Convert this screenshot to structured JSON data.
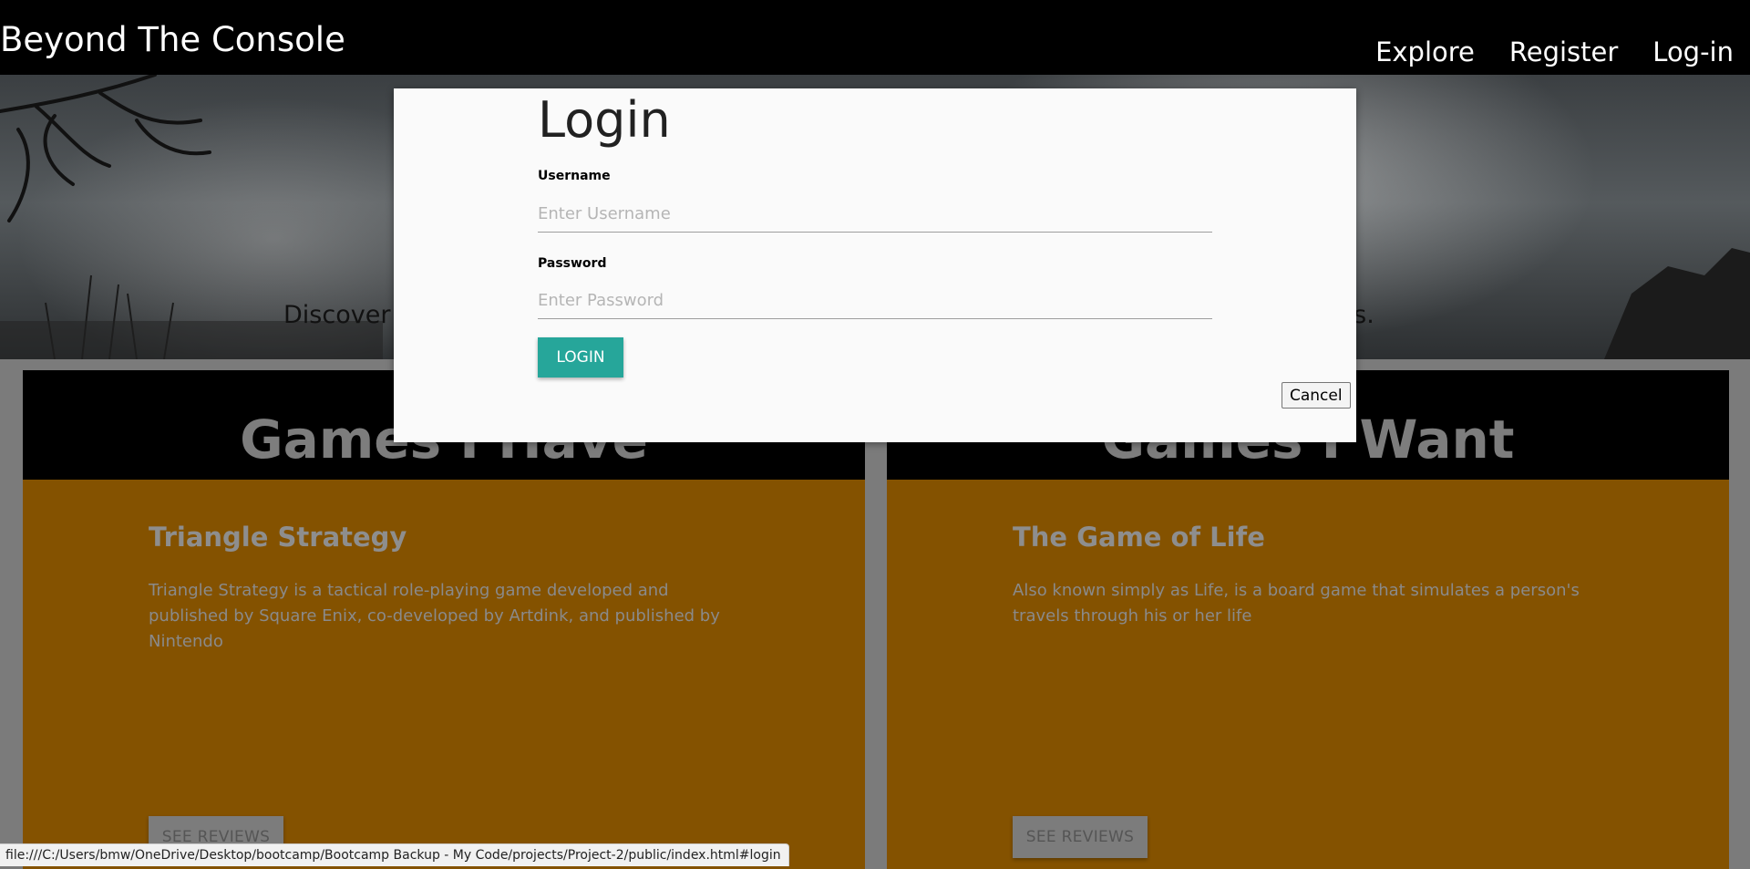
{
  "navbar": {
    "brand": "Beyond The Console",
    "links": [
      "Explore",
      "Register",
      "Log-in"
    ]
  },
  "hero": {
    "tagline_start": "Discover",
    "tagline_end": "ds."
  },
  "cards": [
    {
      "heading": "Games I Have",
      "game_title": "Triangle Strategy",
      "game_desc": "Triangle Strategy is a tactical role-playing game developed and published by Square Enix, co-developed by Artdink, and published by Nintendo",
      "button": "SEE REVIEWS"
    },
    {
      "heading": "Games I Want",
      "game_title": "The Game of Life",
      "game_desc": "Also known simply as Life, is a board game that simulates a person's travels through his or her life",
      "button": "SEE REVIEWS"
    }
  ],
  "modal": {
    "title": "Login",
    "username_label": "Username",
    "username_placeholder": "Enter Username",
    "password_label": "Password",
    "password_placeholder": "Enter Password",
    "login_button": "LOGIN",
    "cancel_button": "Cancel"
  },
  "status_bar": {
    "url": "file:///C:/Users/bmw/OneDrive/Desktop/bootcamp/Bootcamp Backup - My Code/projects/Project-2/public/index.html#login"
  },
  "colors": {
    "navbar": "#000000",
    "card_body": "#845200",
    "login_button": "#26a69a",
    "modal_bg": "#fafafa"
  }
}
